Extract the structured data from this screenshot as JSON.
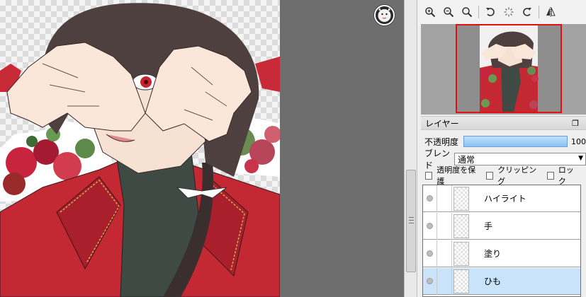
{
  "toolbar": {
    "buttons": [
      {
        "name": "zoom-in-icon"
      },
      {
        "name": "zoom-out-icon"
      },
      {
        "name": "zoom-reset-icon"
      },
      {
        "name": "rotate-left-icon"
      },
      {
        "name": "rotate-reset-icon"
      },
      {
        "name": "rotate-right-icon"
      },
      {
        "name": "flip-horizontal-icon"
      }
    ]
  },
  "layer_panel": {
    "title": "レイヤー",
    "opacity_label": "不透明度",
    "opacity_value": "100",
    "opacity_fraction": 1.0,
    "blend_label": "ブレンド",
    "blend_value": "通常",
    "checks": {
      "protect_alpha": "透明度を保護",
      "clipping": "クリッピング",
      "lock": "ロック"
    },
    "layers": [
      {
        "name": "ハイライト",
        "selected": false
      },
      {
        "name": "手",
        "selected": false
      },
      {
        "name": "塗り",
        "selected": false
      },
      {
        "name": "ひも",
        "selected": true
      }
    ]
  },
  "colors": {
    "selection": "#c8e3fa",
    "navigator_frame": "#e01010",
    "opacity_bar": "#8cc4f3"
  }
}
